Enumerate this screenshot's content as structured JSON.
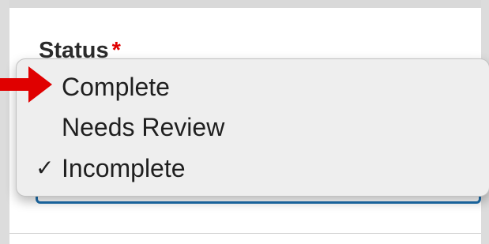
{
  "field": {
    "label": "Status",
    "required_marker": "*"
  },
  "dropdown": {
    "options": [
      {
        "label": "Complete",
        "selected": false,
        "highlighted_by_arrow": true
      },
      {
        "label": "Needs Review",
        "selected": false,
        "highlighted_by_arrow": false
      },
      {
        "label": "Incomplete",
        "selected": true,
        "highlighted_by_arrow": false
      }
    ],
    "check_glyph": "✓"
  },
  "colors": {
    "required": "#e00000",
    "arrow": "#e00000",
    "focus_border": "#1d6fae",
    "menu_background": "#eeeeee"
  },
  "icons": {
    "pointer": "red-arrow-icon",
    "selected": "checkmark-icon"
  }
}
